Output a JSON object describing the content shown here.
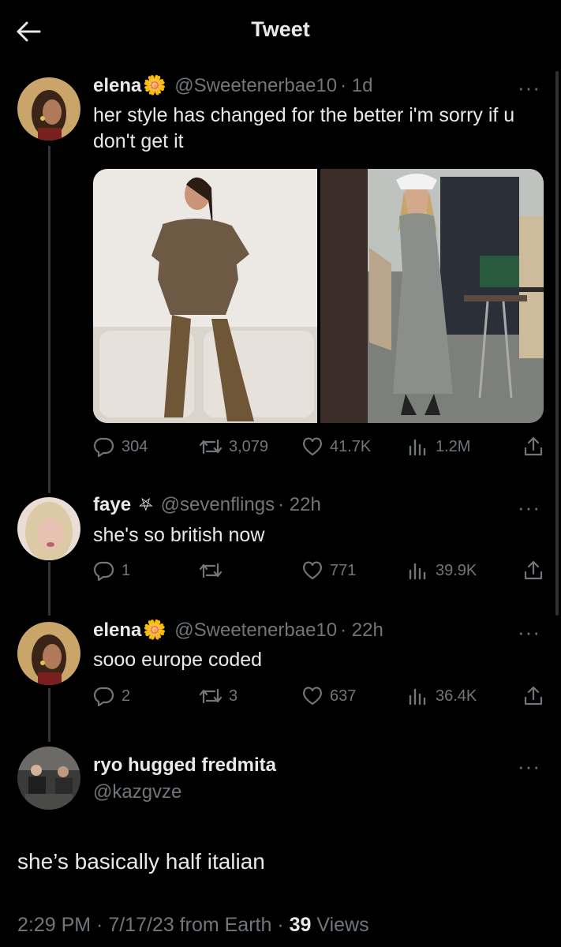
{
  "header": {
    "title": "Tweet"
  },
  "tweets": [
    {
      "name": "elena",
      "emoji": "🌼",
      "handle": "@Sweetenerbae10",
      "time": "· 1d",
      "text": "her style has changed for the better i'm sorry if u don't get it",
      "more": "···",
      "stats": {
        "replies": "304",
        "retweets": "3,079",
        "likes": "41.7K",
        "views": "1.2M"
      }
    },
    {
      "name": "faye",
      "emoji": "⛧",
      "handle": "@sevenflings",
      "time": "· 22h",
      "text": "she's so british now",
      "more": "···",
      "stats": {
        "replies": "1",
        "retweets": "",
        "likes": "771",
        "views": "39.9K"
      }
    },
    {
      "name": "elena",
      "emoji": "🌼",
      "handle": "@Sweetenerbae10",
      "time": "· 22h",
      "text": "sooo europe coded",
      "more": "···",
      "stats": {
        "replies": "2",
        "retweets": "3",
        "likes": "637",
        "views": "36.4K"
      }
    }
  ],
  "main": {
    "name": "ryo hugged fredmita",
    "handle": "@kazgvze",
    "more": "···",
    "text": "she’s basically half italian",
    "footer": {
      "time": "2:29 PM · 7/17/23 from Earth · ",
      "views_count": "39",
      "views_label": " Views"
    }
  },
  "colors": {
    "background": "#000000",
    "text": "#e7e9ea",
    "muted": "#71767b",
    "line": "#333639"
  }
}
